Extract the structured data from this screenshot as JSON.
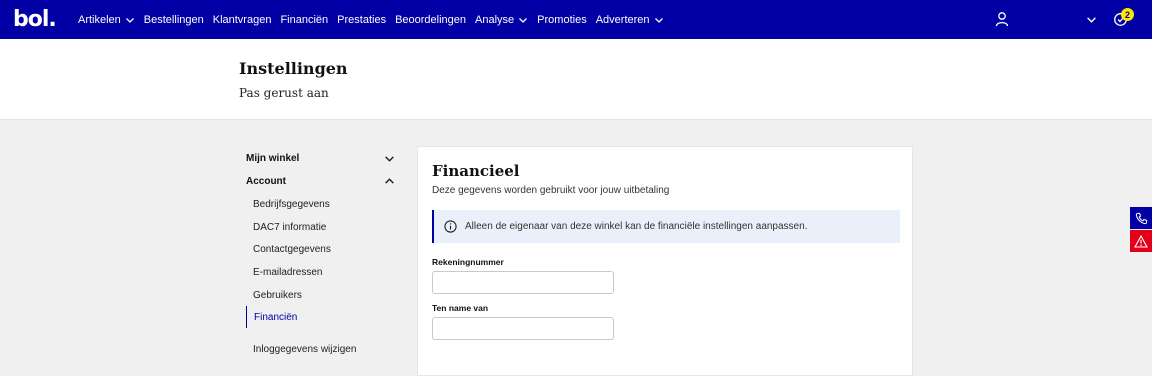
{
  "brand": {
    "logo_text": "bol.",
    "primary_color": "#0000a4",
    "badge_color": "#ffe600",
    "alert_color": "#e3001b"
  },
  "nav": {
    "items": [
      {
        "label": "Artikelen",
        "has_dropdown": true
      },
      {
        "label": "Bestellingen",
        "has_dropdown": false
      },
      {
        "label": "Klantvragen",
        "has_dropdown": false
      },
      {
        "label": "Financiën",
        "has_dropdown": false
      },
      {
        "label": "Prestaties",
        "has_dropdown": false
      },
      {
        "label": "Beoordelingen",
        "has_dropdown": false
      },
      {
        "label": "Analyse",
        "has_dropdown": true
      },
      {
        "label": "Promoties",
        "has_dropdown": false
      },
      {
        "label": "Adverteren",
        "has_dropdown": true
      }
    ],
    "right_icons": [
      "user-icon",
      "chevron-down-icon",
      "notification-icon"
    ],
    "notification_count": "2"
  },
  "header": {
    "title": "Instellingen",
    "subtitle": "Pas gerust aan"
  },
  "sidebar": {
    "groups": [
      {
        "label": "Mijn winkel",
        "expanded": false
      },
      {
        "label": "Account",
        "expanded": true
      }
    ],
    "items": [
      {
        "label": "Bedrijfsgegevens",
        "active": false
      },
      {
        "label": "DAC7 informatie",
        "active": false
      },
      {
        "label": "Contactgegevens",
        "active": false
      },
      {
        "label": "E-mailadressen",
        "active": false
      },
      {
        "label": "Gebruikers",
        "active": false
      },
      {
        "label": "Financiën",
        "active": true
      },
      {
        "label": "Inloggegevens wijzigen",
        "active": false
      }
    ]
  },
  "main": {
    "title": "Financieel",
    "description": "Deze gegevens worden gebruikt voor jouw uitbetaling",
    "notice": "Alleen de eigenaar van deze winkel kan de financiële instellingen aanpassen.",
    "fields": [
      {
        "label": "Rekeningnummer",
        "value": ""
      },
      {
        "label": "Ten name van",
        "value": ""
      }
    ]
  },
  "side_tabs": [
    "phone-icon",
    "warning-icon"
  ]
}
